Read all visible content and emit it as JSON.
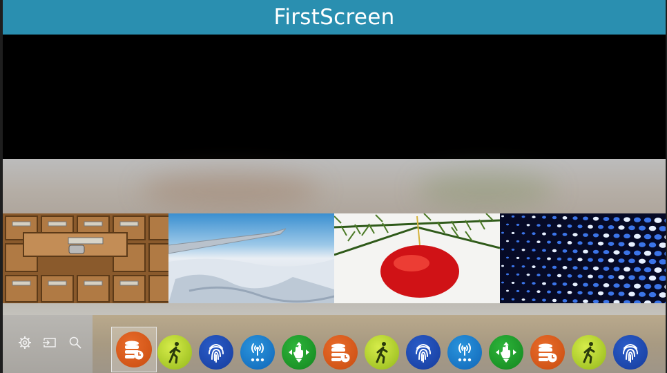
{
  "window": {
    "title": "FirstScreen"
  },
  "thumbnails": [
    {
      "name": "card-catalog-drawers"
    },
    {
      "name": "aerial-wing-snow"
    },
    {
      "name": "christmas-ornament"
    },
    {
      "name": "blue-dots-pattern"
    }
  ],
  "controls": [
    {
      "icon": "gear-icon"
    },
    {
      "icon": "input-source-icon"
    },
    {
      "icon": "search-icon"
    }
  ],
  "apps": [
    {
      "icon": "database-clock-icon",
      "color": "#d9581a",
      "focused": true
    },
    {
      "icon": "walking-person-icon",
      "color": "#b5d22e"
    },
    {
      "icon": "fingerprint-icon",
      "color": "#1d4db4"
    },
    {
      "icon": "wireless-antenna-icon",
      "color": "#1a7fcf"
    },
    {
      "icon": "hand-arrows-icon",
      "color": "#1f9e2c"
    },
    {
      "icon": "database-clock-icon",
      "color": "#d9581a"
    },
    {
      "icon": "walking-person-icon",
      "color": "#b5d22e"
    },
    {
      "icon": "fingerprint-icon",
      "color": "#1d4db4"
    },
    {
      "icon": "wireless-antenna-icon",
      "color": "#1a7fcf"
    },
    {
      "icon": "hand-arrows-icon",
      "color": "#1f9e2c"
    },
    {
      "icon": "database-clock-icon",
      "color": "#d9581a"
    },
    {
      "icon": "walking-person-icon",
      "color": "#b5d22e"
    },
    {
      "icon": "fingerprint-icon",
      "color": "#1d4db4"
    }
  ]
}
